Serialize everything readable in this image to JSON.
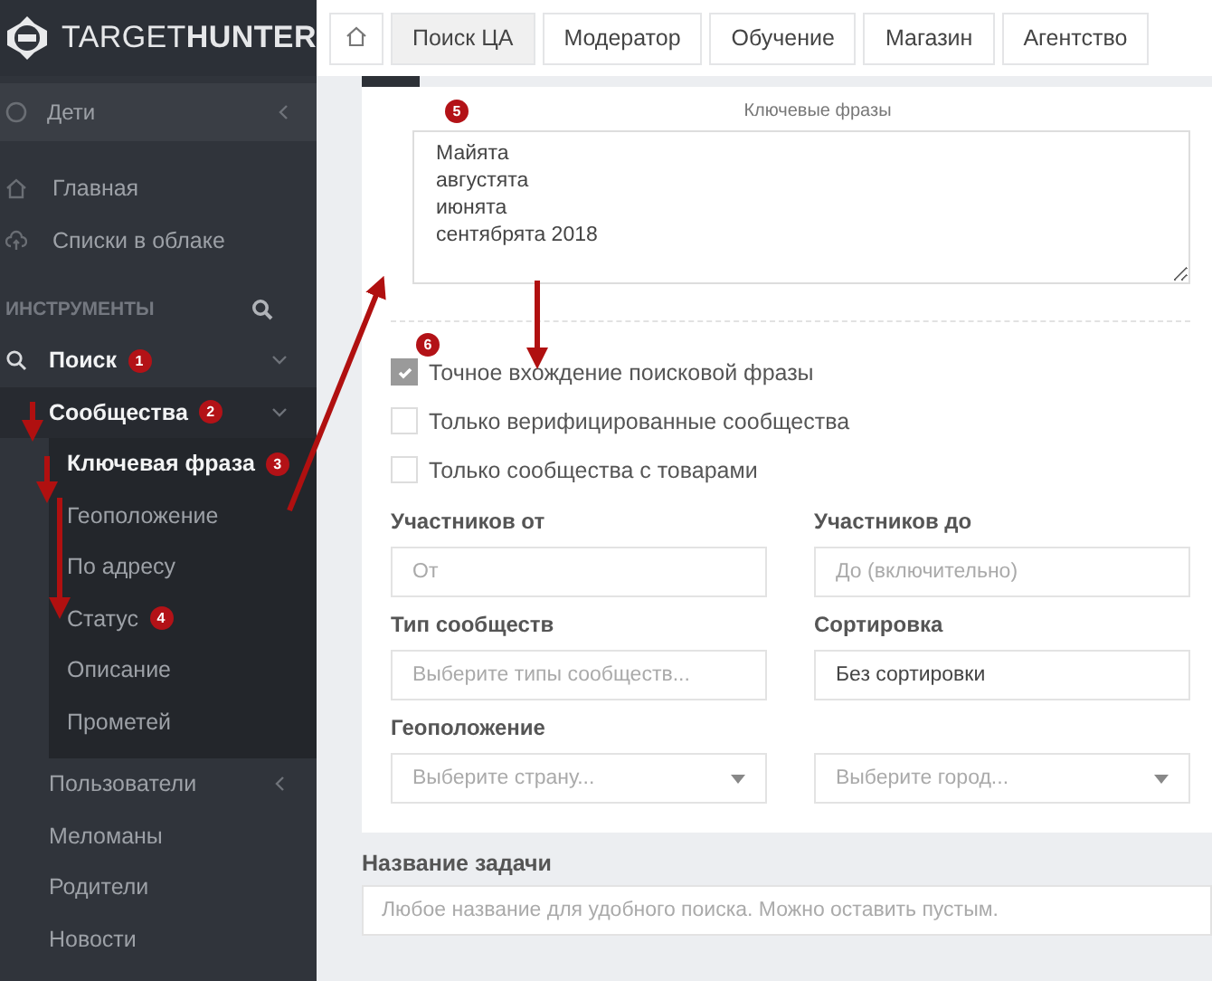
{
  "logo": "TARGET**HUNTER**",
  "sidebar": {
    "pinned": {
      "label": "Дети",
      "expanded": false
    },
    "items": [
      {
        "label": "Главная"
      },
      {
        "label": "Списки в облаке"
      }
    ],
    "section": "ИНСТРУМЕНТЫ",
    "tools": [
      {
        "label": "Поиск",
        "badge": "1",
        "expanded": true,
        "children": [
          {
            "label": "Сообщества",
            "badge": "2",
            "expanded": true,
            "children": [
              {
                "label": "Ключевая фраза",
                "badge": "3",
                "selected": true
              },
              {
                "label": "Геоположение",
                "selected": false
              },
              {
                "label": "По адресу",
                "selected": false
              },
              {
                "label": "Статус",
                "badge": "4",
                "selected": false
              },
              {
                "label": "Описание",
                "selected": false
              },
              {
                "label": "Прометей",
                "selected": false
              }
            ]
          },
          {
            "label": "Пользователи",
            "expanded": false
          },
          {
            "label": "Меломаны"
          },
          {
            "label": "Родители"
          },
          {
            "label": "Новости"
          }
        ]
      }
    ]
  },
  "tabs": [
    {
      "label": "Поиск ЦА",
      "selected": true
    },
    {
      "label": "Модератор",
      "selected": false
    },
    {
      "label": "Обучение",
      "selected": false
    },
    {
      "label": "Магазин",
      "selected": false
    },
    {
      "label": "Агентство",
      "selected": false
    }
  ],
  "keywords": {
    "label": "Ключевые фразы",
    "badge": "5",
    "value": "Майята\nавгустята\nиюнята\nсентябрята 2018"
  },
  "checkboxes": [
    {
      "label": "Точное вхождение поисковой фразы",
      "checked": true,
      "badge": "6"
    },
    {
      "label": "Только верифицированные сообщества",
      "checked": false
    },
    {
      "label": "Только сообщества с товарами",
      "checked": false
    }
  ],
  "rows": [
    {
      "fields": [
        {
          "label": "Участников от",
          "kind": "input",
          "placeholder": "От"
        },
        {
          "label": "Участников до",
          "kind": "input",
          "placeholder": "До (включительно)"
        }
      ]
    },
    {
      "fields": [
        {
          "label": "Тип сообществ",
          "kind": "input",
          "placeholder": "Выберите типы сообществ..."
        },
        {
          "label": "Сортировка",
          "kind": "input",
          "value": "Без сортировки"
        }
      ]
    },
    {
      "fields": [
        {
          "label": "Геоположение",
          "kind": "select",
          "placeholder": "Выберите страну..."
        },
        {
          "kind": "select",
          "placeholder": "Выберите город..."
        }
      ]
    }
  ],
  "task": {
    "label": "Название задачи",
    "placeholder": "Любое название для удобного поиска. Можно оставить пустым."
  }
}
